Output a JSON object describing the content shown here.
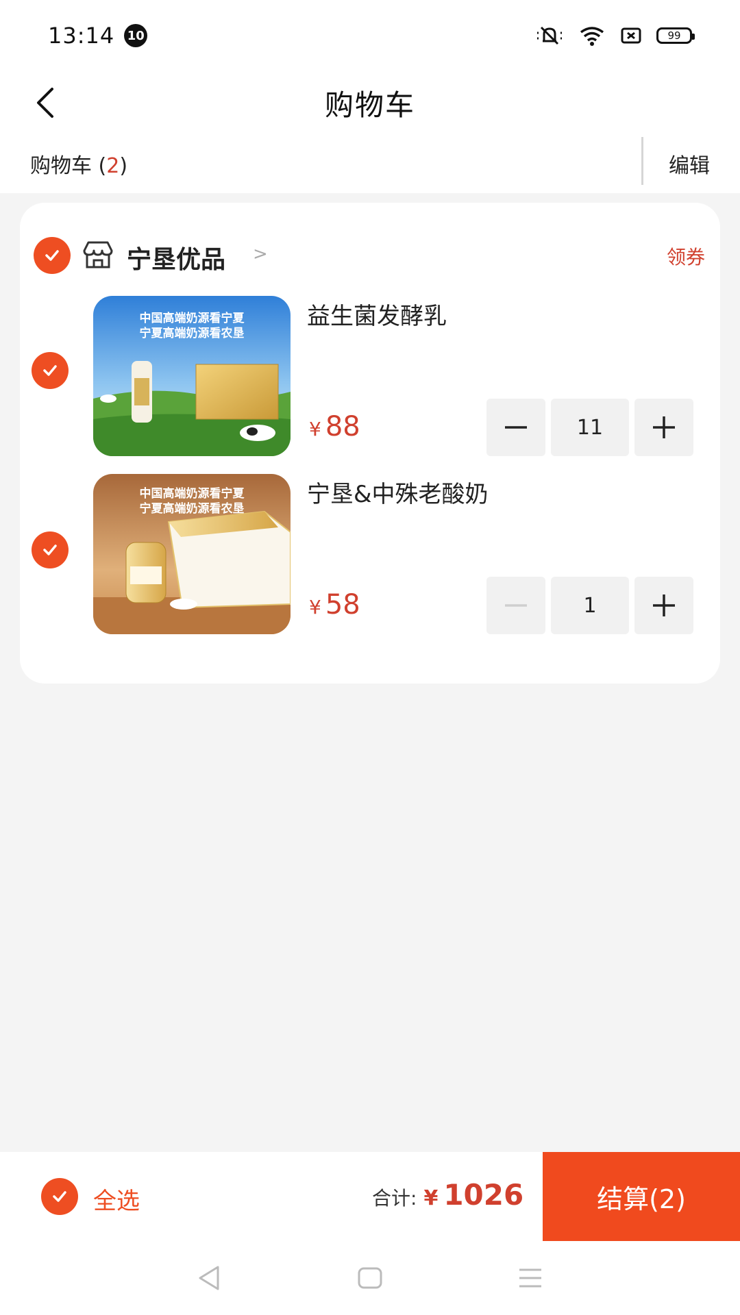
{
  "status_bar": {
    "time": "13:14",
    "notification_count": "10",
    "battery_level": "99"
  },
  "nav": {
    "title": "购物车"
  },
  "subheader": {
    "cart_label": "购物车 (",
    "cart_count": "2",
    "cart_label_end": ")",
    "edit_label": "编辑"
  },
  "store": {
    "name": "宁垦优品",
    "arrow": ">",
    "coupon_label": "领券"
  },
  "items": [
    {
      "name": "益生菌发酵乳",
      "currency": "¥",
      "price": "88",
      "quantity": "11",
      "image_caption_1": "中国高端奶源看宁夏",
      "image_caption_2": "宁夏高端奶源看农垦"
    },
    {
      "name": "宁垦&中殊老酸奶",
      "currency": "¥",
      "price": "58",
      "quantity": "1",
      "image_caption_1": "中国高端奶源看宁夏",
      "image_caption_2": "宁夏高端奶源看农垦"
    }
  ],
  "footer": {
    "select_all_label": "全选",
    "total_label": "合计:",
    "total_currency": "¥",
    "total_value": "1026",
    "checkout_label": "结算(2)"
  },
  "colors": {
    "accent": "#ee4e22",
    "price": "#d0402e",
    "checkout": "#f04a1e"
  }
}
